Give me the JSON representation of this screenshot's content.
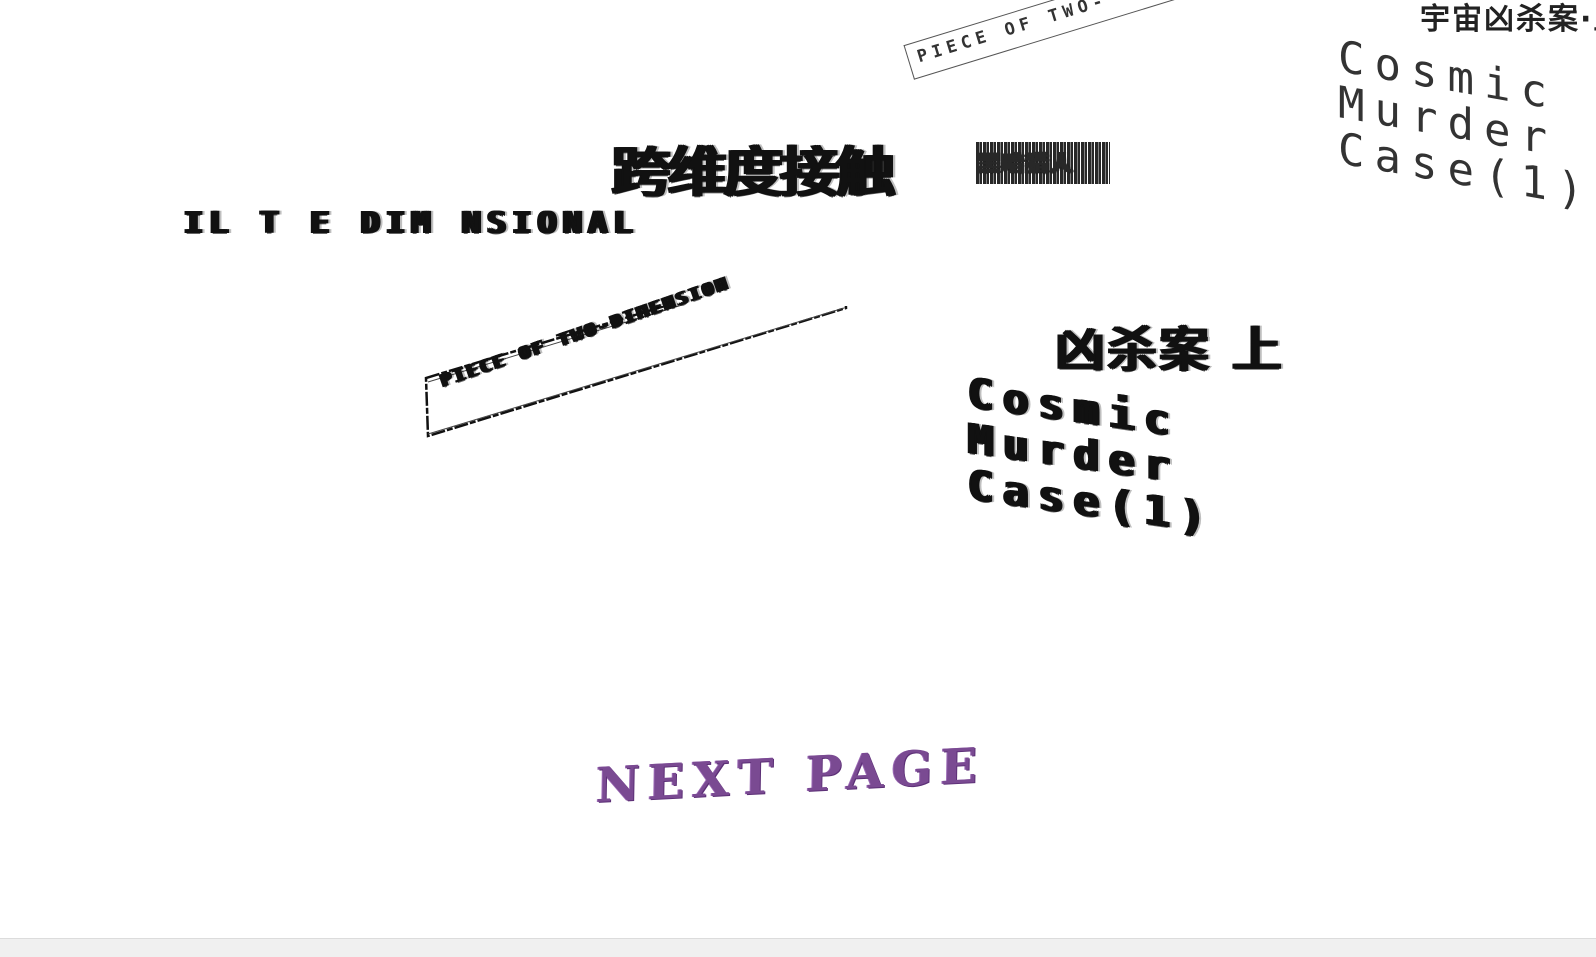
{
  "artwork_top_right": {
    "banner_text": "PIECE OF TWO-",
    "cn_title": "宇宙凶杀案·上",
    "en_lines": [
      "Cosmic",
      "Murder",
      "Case(1)"
    ]
  },
  "artwork_glitched": {
    "cn_title": "跨维度接触",
    "cn_title_small": "黑暗猎人",
    "en_spread": "IL T E DIM NSIONAL",
    "banner_text": "PIECE OF TWO-DIMENSION",
    "cn_mid": "凶杀案 上",
    "en_lines": [
      "Cosmic",
      "Murder",
      "Case(1)"
    ]
  },
  "navigation": {
    "next_page_label": "NEXT PAGE"
  },
  "colors": {
    "next_page": "#7a4a92",
    "artwork_ink": "#111111",
    "background": "#ffffff"
  }
}
